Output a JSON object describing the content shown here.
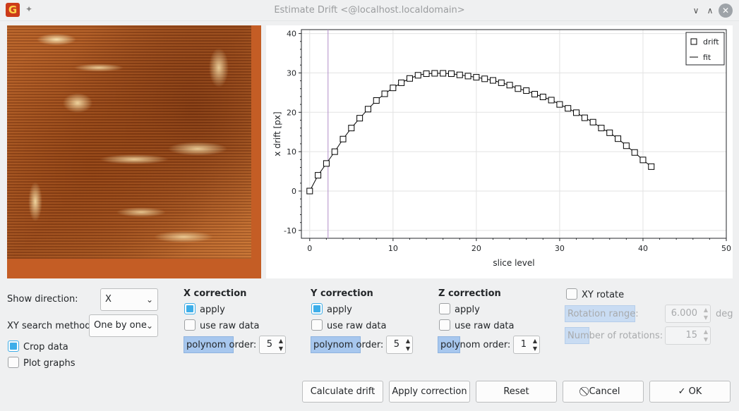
{
  "window": {
    "title": "Estimate Drift <@localhost.localdomain>",
    "app_icon": "G",
    "pin_glyph": "✦",
    "minimize_glyph": "∨",
    "maximize_glyph": "∧",
    "close_glyph": "✕"
  },
  "controls": {
    "show_direction_label": "Show direction:",
    "show_direction_value": "X",
    "xy_search_label": "XY search method:",
    "xy_search_value": "One by one",
    "crop_data_label": "Crop data",
    "crop_data_checked": true,
    "plot_graphs_label": "Plot graphs",
    "plot_graphs_checked": false,
    "chevron": "⌄"
  },
  "x_correction": {
    "title": "X correction",
    "apply_label": "apply",
    "apply_checked": true,
    "raw_label": "use raw data",
    "raw_checked": false,
    "order_label": "polynom order:",
    "order_value": "5"
  },
  "y_correction": {
    "title": "Y correction",
    "apply_label": "apply",
    "apply_checked": true,
    "raw_label": "use raw data",
    "raw_checked": false,
    "order_label": "polynom order:",
    "order_value": "5"
  },
  "z_correction": {
    "title": "Z correction",
    "apply_label": "apply",
    "apply_checked": false,
    "raw_label": "use raw data",
    "raw_checked": false,
    "order_label": "polynom order:",
    "order_value": "1"
  },
  "rotation": {
    "xy_rotate_label": "XY rotate",
    "xy_rotate_checked": false,
    "range_label": "Rotation range:",
    "range_value": "6.000",
    "range_unit": "deg",
    "count_label": "Number of rotations:",
    "count_value": "15"
  },
  "buttons": {
    "calculate": "Calculate drift",
    "apply": "Apply correction",
    "reset": "Reset",
    "cancel": "Cancel",
    "cancel_icon": "⃠",
    "ok": "OK",
    "ok_icon": "✓"
  },
  "chart_data": {
    "type": "scatter",
    "title": "",
    "xlabel": "slice level",
    "ylabel": "x drift [px]",
    "xlim": [
      -1,
      50
    ],
    "ylim": [
      -12,
      41
    ],
    "xticks": [
      0,
      10,
      20,
      30,
      40,
      50
    ],
    "yticks": [
      -10,
      0,
      10,
      20,
      30,
      40
    ],
    "grid": true,
    "legend_position": "top-right",
    "cursor_x": 2.2,
    "series": [
      {
        "name": "drift",
        "style": "square-markers",
        "x": [
          0,
          1,
          2,
          3,
          4,
          5,
          6,
          7,
          8,
          9,
          10,
          11,
          12,
          13,
          14,
          15,
          16,
          17,
          18,
          19,
          20,
          21,
          22,
          23,
          24,
          25,
          26,
          27,
          28,
          29,
          30,
          31,
          32,
          33,
          34,
          35,
          36,
          37,
          38,
          39,
          40,
          41
        ],
        "y": [
          0,
          4,
          7,
          10,
          13.2,
          16,
          18.5,
          20.8,
          23,
          24.7,
          26.2,
          27.5,
          28.6,
          29.4,
          29.8,
          29.9,
          29.9,
          29.8,
          29.5,
          29.2,
          28.9,
          28.5,
          28.1,
          27.5,
          26.9,
          26,
          25.5,
          24.6,
          23.9,
          23.1,
          22,
          21,
          19.9,
          18.6,
          17.5,
          16,
          14.8,
          13.3,
          11.5,
          9.8,
          7.9,
          6.2
        ]
      },
      {
        "name": "fit",
        "style": "line",
        "x": [
          0,
          1,
          2,
          3,
          4,
          5,
          6,
          7,
          8,
          9,
          10,
          11,
          12,
          13,
          14,
          15,
          16,
          17,
          18,
          19,
          20,
          21,
          22,
          23,
          24,
          25,
          26,
          27,
          28,
          29,
          30,
          31,
          32,
          33,
          34,
          35,
          36,
          37,
          38,
          39,
          40,
          41
        ],
        "y": [
          0,
          4,
          7,
          10,
          13.2,
          16,
          18.5,
          20.8,
          23,
          24.7,
          26.2,
          27.5,
          28.6,
          29.4,
          29.8,
          29.9,
          29.9,
          29.8,
          29.5,
          29.2,
          28.9,
          28.5,
          28.1,
          27.5,
          26.9,
          26,
          25.5,
          24.6,
          23.9,
          23.1,
          22,
          21,
          19.9,
          18.6,
          17.5,
          16,
          14.8,
          13.3,
          11.5,
          9.8,
          7.9,
          6.2
        ]
      }
    ]
  }
}
